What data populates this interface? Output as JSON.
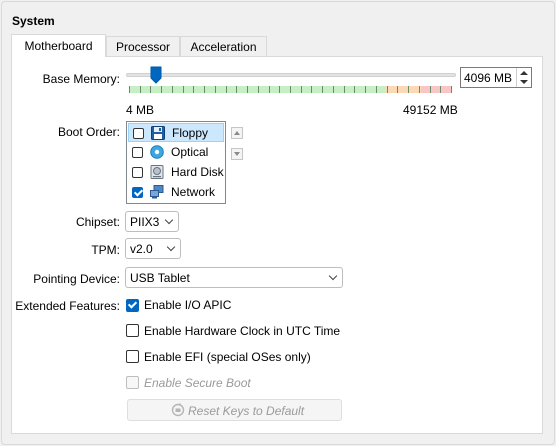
{
  "group": {
    "title": "System"
  },
  "tabs": [
    {
      "label": "Motherboard",
      "active": true
    },
    {
      "label": "Processor",
      "active": false
    },
    {
      "label": "Acceleration",
      "active": false
    }
  ],
  "memory": {
    "label": "Base Memory:",
    "value": "4096 MB",
    "min_label": "4 MB",
    "max_label": "49152 MB",
    "slider_fraction": 0.083
  },
  "boot_order": {
    "label": "Boot Order:",
    "items": [
      {
        "label": "Floppy",
        "checked": false,
        "icon": "floppy-icon"
      },
      {
        "label": "Optical",
        "checked": false,
        "icon": "optical-disc-icon"
      },
      {
        "label": "Hard Disk",
        "checked": false,
        "icon": "hard-disk-icon"
      },
      {
        "label": "Network",
        "checked": true,
        "icon": "network-icon"
      }
    ]
  },
  "chipset": {
    "label": "Chipset:",
    "value": "PIIX3"
  },
  "tpm": {
    "label": "TPM:",
    "value": "v2.0"
  },
  "pointing": {
    "label": "Pointing Device:",
    "value": "USB Tablet"
  },
  "features": {
    "label": "Extended Features:",
    "io_apic": {
      "label": "Enable I/O APIC",
      "checked": true
    },
    "utc": {
      "label": "Enable Hardware Clock in UTC Time",
      "checked": false
    },
    "efi": {
      "label": "Enable EFI (special OSes only)",
      "checked": false
    },
    "secure_boot": {
      "label": "Enable Secure Boot",
      "checked": false,
      "disabled": true
    }
  },
  "reset_button": {
    "label": "Reset Keys to Default",
    "icon": "reset-keys-icon"
  },
  "colors": {
    "accent": "#0067c0",
    "slider_green": "#c6efc6",
    "slider_orange": "#fbd9b6",
    "slider_red": "#f8c6c6",
    "selection": "#cce8ff"
  }
}
